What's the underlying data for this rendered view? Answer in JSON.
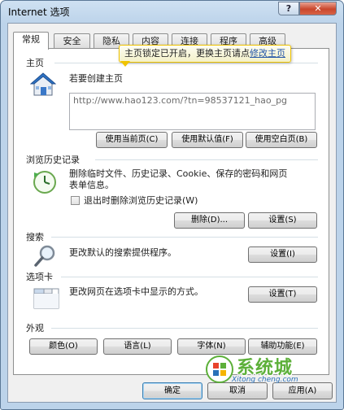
{
  "window": {
    "title": "Internet 选项",
    "help_label": "?",
    "close_label": "✕"
  },
  "tabs": [
    {
      "label": "常规"
    },
    {
      "label": "安全"
    },
    {
      "label": "隐私"
    },
    {
      "label": "内容"
    },
    {
      "label": "连接"
    },
    {
      "label": "程序"
    },
    {
      "label": "高级"
    }
  ],
  "homepage": {
    "section_label": "主页",
    "instruction": "若要创建主页",
    "url": "http://www.hao123.com/?tn=98537121_hao_pg",
    "tooltip_text": "主页锁定已开启，更换主页请点",
    "tooltip_link": "修改主页",
    "btn_current": "使用当前页(C)",
    "btn_default": "使用默认值(F)",
    "btn_blank": "使用空白页(B)"
  },
  "history": {
    "section_label": "浏览历史记录",
    "description_1": "删除临时文件、历史记录、Cookie、保存的密码和网页",
    "description_2": "表单信息。",
    "checkbox_label": "退出时删除浏览历史记录(W)",
    "btn_delete": "删除(D)...",
    "btn_settings": "设置(S)"
  },
  "search": {
    "section_label": "搜索",
    "description": "更改默认的搜索提供程序。",
    "btn_settings": "设置(I)"
  },
  "tabs_section": {
    "section_label": "选项卡",
    "description": "更改网页在选项卡中显示的方式。",
    "btn_settings": "设置(T)"
  },
  "appearance": {
    "section_label": "外观",
    "btn_colors": "颜色(O)",
    "btn_languages": "语言(L)",
    "btn_fonts": "字体(N)",
    "btn_accessibility": "辅助功能(E)"
  },
  "footer": {
    "btn_ok": "确定",
    "btn_cancel": "取消",
    "btn_apply": "应用(A)"
  },
  "watermark": {
    "text": "系统城",
    "sub": "Xitong cheng.com"
  },
  "colors": {
    "tooltip_border": "#f0c300",
    "link": "#2455a8",
    "watermark_green": "#5db03a"
  }
}
